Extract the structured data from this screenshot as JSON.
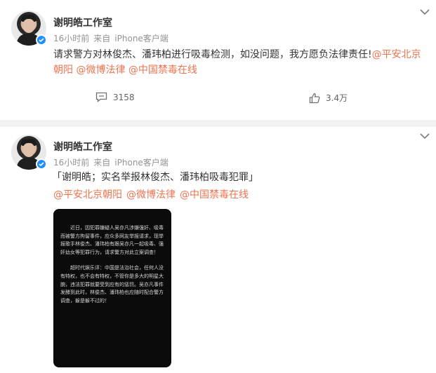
{
  "post1": {
    "author": "谢明皓工作室",
    "time": "16小时前",
    "source_prefix": "来自",
    "source": "iPhone客户端",
    "text": "请求警方对林俊杰、潘玮柏进行吸毒检测，如没问题，我方愿负法律责任!",
    "mentions": [
      "@平安北京朝阳",
      "@微博法律",
      "@中国禁毒在线"
    ],
    "comment_count": "3158",
    "like_count": "3.4万"
  },
  "post2": {
    "author": "谢明皓工作室",
    "time": "16小时前",
    "source_prefix": "来自",
    "source": "iPhone客户端",
    "quote_title": "「谢明皓；实名举报林俊杰、潘玮柏吸毒犯罪」",
    "mentions": [
      "@平安北京朝阳",
      "@微博法律",
      "@中国禁毒在线"
    ],
    "image_paragraphs": [
      "近日，因犯罪嫌疑人吴亦凡涉嫌强奸、吸毒而被警方拘留事件，应众多网友举报请求，现举报歌手林俊杰、潘玮柏有跟吴亦凡一起吸毒、强奸幼女等犯罪行为，请求警方对此立案调查！",
      "超时代娱乐评：中国是法治社会，任何人没有特权，也不会有特权，不管你是多大的明星大腕，违法犯罪就要受到应有的惩罚。吴亦凡事件发酵到此时，林俊杰、潘玮柏也应随时配合警方调查，躲是躲不过的！"
    ]
  },
  "colors": {
    "link": "#eb7350",
    "meta": "#939393",
    "verified": "#1e90ff",
    "gap": "#f2f2f2"
  },
  "icons": [
    "avatar",
    "verified-badge-icon",
    "chevron-down-icon",
    "comment-icon",
    "like-icon"
  ]
}
